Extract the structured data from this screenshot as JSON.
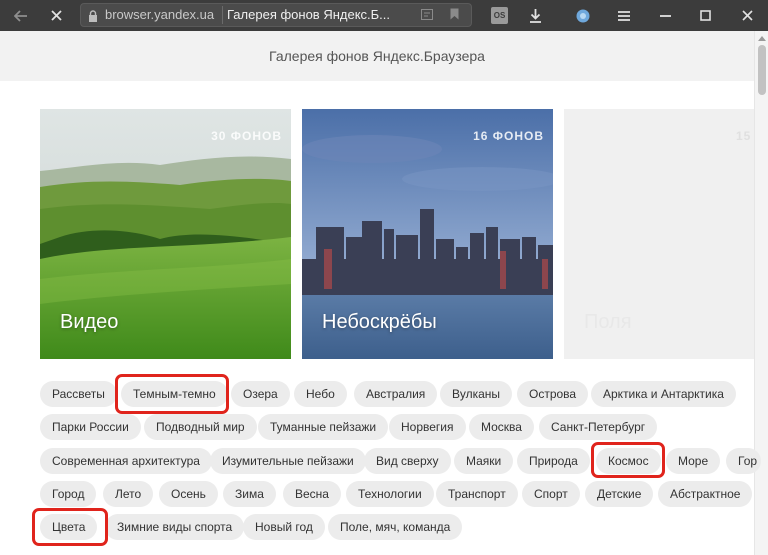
{
  "browser": {
    "url_host": "browser.yandex.ua",
    "tab_title": "Галерея фонов Яндекс.Б...",
    "extension_badge": "OS"
  },
  "page": {
    "title": "Галерея фонов Яндекс.Браузера"
  },
  "cards": [
    {
      "label": "Видео",
      "count": "30 ФОНОВ"
    },
    {
      "label": "Небоскрёбы",
      "count": "16 ФОНОВ"
    },
    {
      "label": "Поля",
      "count": "15"
    }
  ],
  "tags": {
    "row1": [
      "Рассветы",
      "Темным-темно",
      "Озера",
      "Небо",
      "Австралия",
      "Вулканы",
      "Острова",
      "Арктика и Антарктика"
    ],
    "row2": [
      "Парки России",
      "Подводный мир",
      "Туманные пейзажи",
      "Норвегия",
      "Москва",
      "Санкт-Петербург"
    ],
    "row3": [
      "Современная архитектура",
      "Изумительные пейзажи",
      "Вид сверху",
      "Маяки",
      "Природа",
      "Космос",
      "Море",
      "Гор"
    ],
    "row4": [
      "Город",
      "Лето",
      "Осень",
      "Зима",
      "Весна",
      "Технологии",
      "Транспорт",
      "Спорт",
      "Детские",
      "Абстрактное"
    ],
    "row5": [
      "Цвета",
      "Зимние виды спорта",
      "Новый год",
      "Поле, мяч, команда"
    ]
  },
  "highlighted_tags": [
    "Темным-темно",
    "Космос",
    "Цвета"
  ],
  "colors": {
    "highlight": "#e0241c",
    "chip_bg": "#ececec",
    "topbar": "#3c3c3c"
  }
}
